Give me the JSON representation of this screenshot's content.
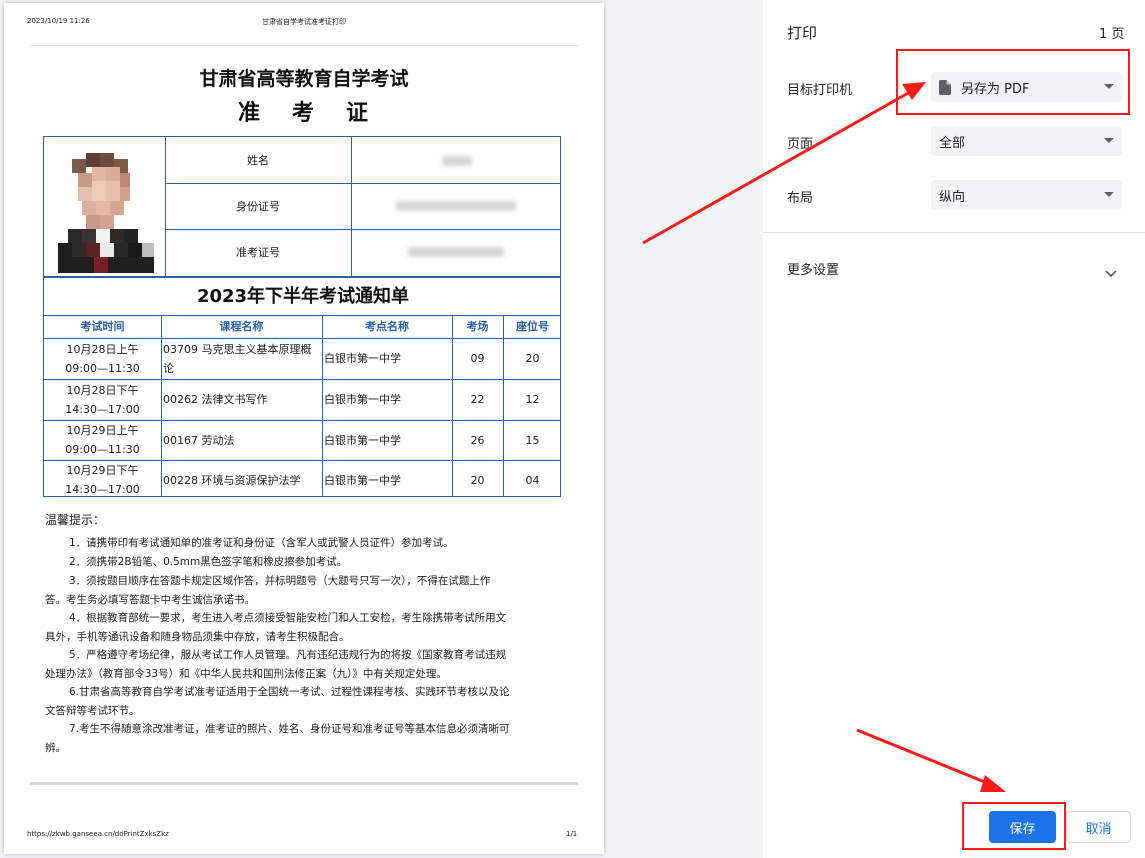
{
  "preview": {
    "header_datetime": "2023/10/19 11:26",
    "header_title": "甘肃省自学考试准考证打印",
    "footer_url": "https://zkwb.ganseea.cn/doPrintZxksZkz",
    "footer_page": "1/1"
  },
  "document": {
    "title_line1": "甘肃省高等教育自学考试",
    "title_line2_chars": [
      "准",
      "考",
      "证"
    ],
    "fields": {
      "name_label": "姓名",
      "id_label": "身份证号",
      "exam_no_label": "准考证号"
    },
    "notice_title": "2023年下半年考试通知单",
    "table_headers": [
      "考试时间",
      "课程名称",
      "考点名称",
      "考场",
      "座位号"
    ],
    "rows": [
      {
        "time1": "10月28日上午",
        "time2": "09:00—11:30",
        "course": "03709 马克思主义基本原理概论",
        "site": "白银市第一中学",
        "room": "09",
        "seat": "20"
      },
      {
        "time1": "10月28日下午",
        "time2": "14:30—17:00",
        "course": "00262 法律文书写作",
        "site": "白银市第一中学",
        "room": "22",
        "seat": "12"
      },
      {
        "time1": "10月29日上午",
        "time2": "09:00—11:30",
        "course": "00167 劳动法",
        "site": "白银市第一中学",
        "room": "26",
        "seat": "15"
      },
      {
        "time1": "10月29日下午",
        "time2": "14:30—17:00",
        "course": "00228 环境与资源保护法学",
        "site": "白银市第一中学",
        "room": "20",
        "seat": "04"
      }
    ],
    "tips_title": "温馨提示：",
    "tips": [
      {
        "line1": "1．请携带印有考试通知单的准考证和身份证（含军人或武警人员证件）参加考试。",
        "line2": ""
      },
      {
        "line1": "2．须携带2B铅笔、0.5mm黑色签字笔和橡皮擦参加考试。",
        "line2": ""
      },
      {
        "line1": "3．须按题目顺序在答题卡规定区域作答，并标明题号（大题号只写一次），不得在试题上作",
        "line2": "答。考生务必填写答题卡中考生诚信承诺书。"
      },
      {
        "line1": "4．根据教育部统一要求，考生进入考点须接受智能安检门和人工安检，考生除携带考试所用文",
        "line2": "具外，手机等通讯设备和随身物品须集中存放，请考生积极配合。"
      },
      {
        "line1": "5．严格遵守考场纪律，服从考试工作人员管理。凡有违纪违规行为的将按《国家教育考试违规",
        "line2": "处理办法》（教育部令33号）和《中华人民共和国刑法修正案（九）》中有关规定处理。"
      },
      {
        "line1": "6.甘肃省高等教育自学考试准考证适用于全国统一考试、过程性课程考核、实践环节考核以及论",
        "line2": "文答辩等考试环节。"
      },
      {
        "line1": "7.考生不得随意涂改准考证，准考证的照片、姓名、身份证号和准考证号等基本信息必须清晰可",
        "line2": "辨。"
      }
    ]
  },
  "print_panel": {
    "title": "打印",
    "page_count": "1 页",
    "destination_label": "目标打印机",
    "destination_value": "另存为 PDF",
    "pages_label": "页面",
    "pages_value": "全部",
    "layout_label": "布局",
    "layout_value": "纵向",
    "more_settings": "更多设置",
    "save_button": "保存",
    "cancel_button": "取消"
  },
  "colors": {
    "accent": "#1a73e8",
    "table_border": "#2b5fa6",
    "highlight": "#ff1a1a"
  }
}
